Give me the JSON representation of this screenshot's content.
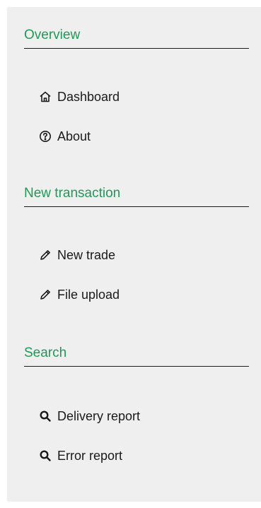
{
  "sections": [
    {
      "title": "Overview",
      "items": [
        {
          "label": "Dashboard",
          "icon": "home-icon"
        },
        {
          "label": "About",
          "icon": "info-icon"
        }
      ]
    },
    {
      "title": "New transaction",
      "items": [
        {
          "label": "New trade",
          "icon": "pencil-icon"
        },
        {
          "label": "File upload",
          "icon": "pencil-icon"
        }
      ]
    },
    {
      "title": "Search",
      "items": [
        {
          "label": "Delivery report",
          "icon": "search-icon"
        },
        {
          "label": "Error report",
          "icon": "search-icon"
        }
      ]
    }
  ],
  "colors": {
    "accent": "#1f9a56",
    "background": "#efefef",
    "text": "#1a1a1a"
  }
}
